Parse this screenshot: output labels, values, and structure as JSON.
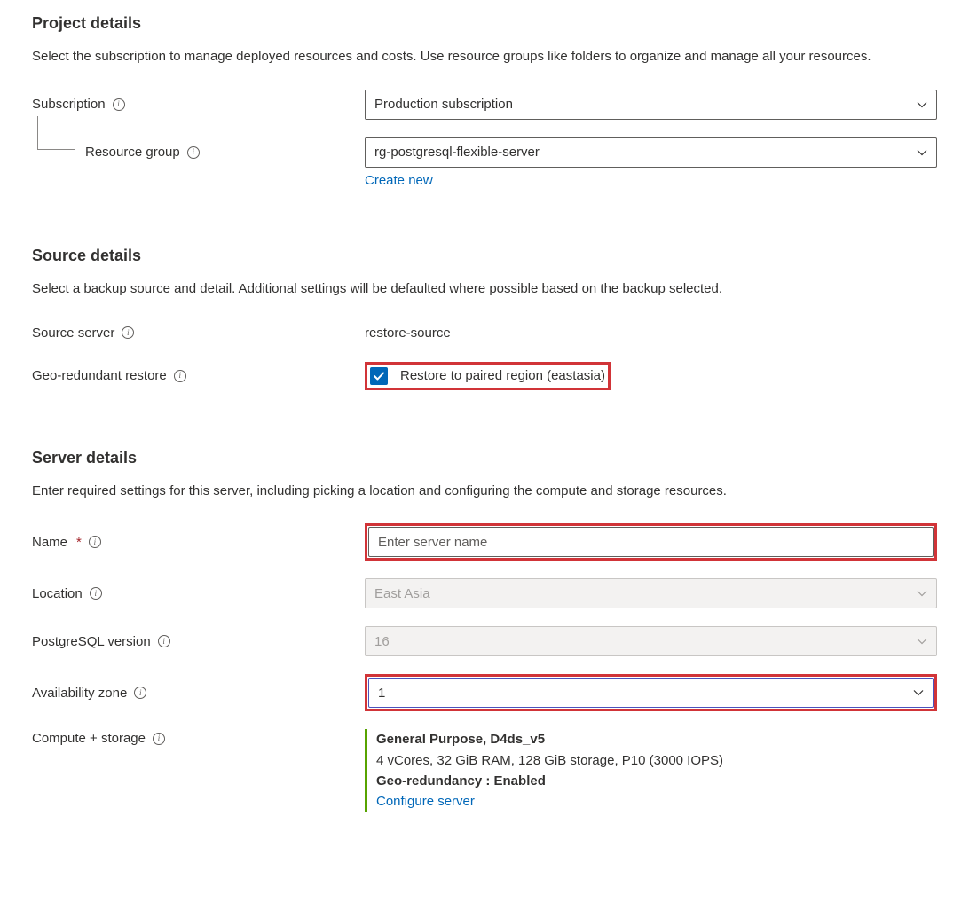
{
  "project": {
    "heading": "Project details",
    "desc": "Select the subscription to manage deployed resources and costs. Use resource groups like folders to organize and manage all your resources.",
    "subscription_label": "Subscription",
    "subscription_value": "Production subscription",
    "resource_group_label": "Resource group",
    "resource_group_value": "rg-postgresql-flexible-server",
    "create_new_link": "Create new"
  },
  "source": {
    "heading": "Source details",
    "desc": "Select a backup source and detail. Additional settings will be defaulted where possible based on the backup selected.",
    "source_server_label": "Source server",
    "source_server_value": "restore-source",
    "geo_restore_label": "Geo-redundant restore",
    "geo_restore_checkbox_label": "Restore to paired region (eastasia)"
  },
  "server": {
    "heading": "Server details",
    "desc": "Enter required settings for this server, including picking a location and configuring the compute and storage resources.",
    "name_label": "Name",
    "name_placeholder": "Enter server name",
    "location_label": "Location",
    "location_value": "East Asia",
    "pg_version_label": "PostgreSQL version",
    "pg_version_value": "16",
    "az_label": "Availability zone",
    "az_value": "1",
    "compute_label": "Compute + storage",
    "compute_tier": "General Purpose, D4ds_v5",
    "compute_detail": "4 vCores, 32 GiB RAM, 128 GiB storage, P10 (3000 IOPS)",
    "compute_geo": "Geo-redundancy : Enabled",
    "configure_link": "Configure server"
  }
}
